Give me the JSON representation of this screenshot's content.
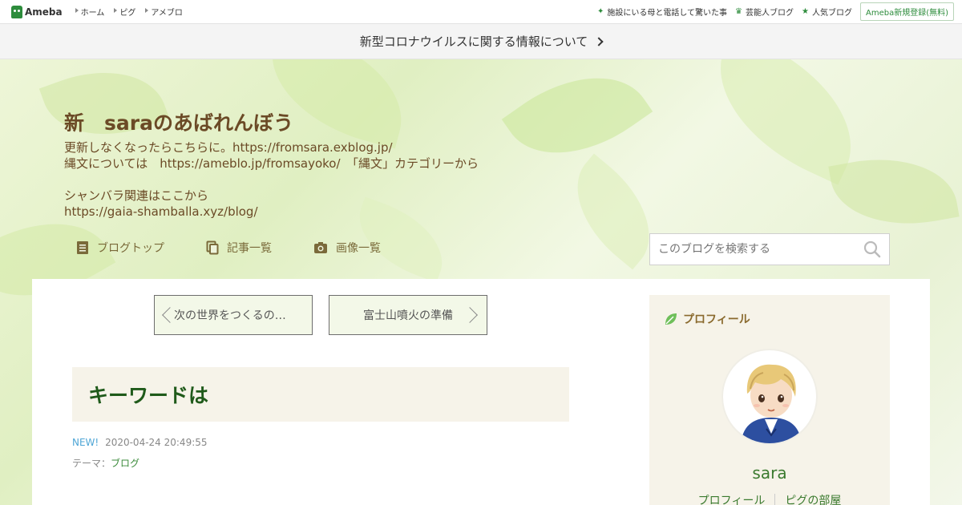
{
  "topbar": {
    "logo": "Ameba",
    "nav": [
      "ホーム",
      "ピグ",
      "アメブロ"
    ],
    "right_links": [
      {
        "icon": "sparkle-icon",
        "label": "施設にいる母と電話して驚いた事"
      },
      {
        "icon": "crown-icon",
        "label": "芸能人ブログ"
      },
      {
        "icon": "star-icon",
        "label": "人気ブログ"
      }
    ],
    "register": "Ameba新規登録(無料)"
  },
  "notice": {
    "text": "新型コロナウイルスに関する情報について"
  },
  "blog": {
    "title": "新　saraのあばれんぼう",
    "description": [
      "更新しなくなったらこちらに。https://fromsara.exblog.jp/",
      "縄文については　https://ameblo.jp/fromsayoko/　「縄文」カテゴリーから",
      "",
      "シャンバラ関連はここから",
      "https://gaia-shamballa.xyz/blog/"
    ]
  },
  "gnav": [
    {
      "icon": "document-icon",
      "label": "ブログトップ"
    },
    {
      "icon": "copy-icon",
      "label": "記事一覧"
    },
    {
      "icon": "camera-icon",
      "label": "画像一覧"
    }
  ],
  "search": {
    "placeholder": "このブログを検索する"
  },
  "pager": {
    "prev": "次の世界をつくるの…",
    "next": "富士山噴火の準備"
  },
  "entry": {
    "title": "キーワードは",
    "new_label": "NEW!",
    "date": "2020-04-24 20:49:55",
    "theme_label": "テーマ：",
    "theme": "ブログ"
  },
  "profile": {
    "heading": "プロフィール",
    "name": "sara",
    "links": [
      "プロフィール",
      "ピグの部屋"
    ]
  },
  "colors": {
    "accent": "#2d8c3c",
    "title": "#6b4a26",
    "entry_title": "#1f5a1a"
  }
}
